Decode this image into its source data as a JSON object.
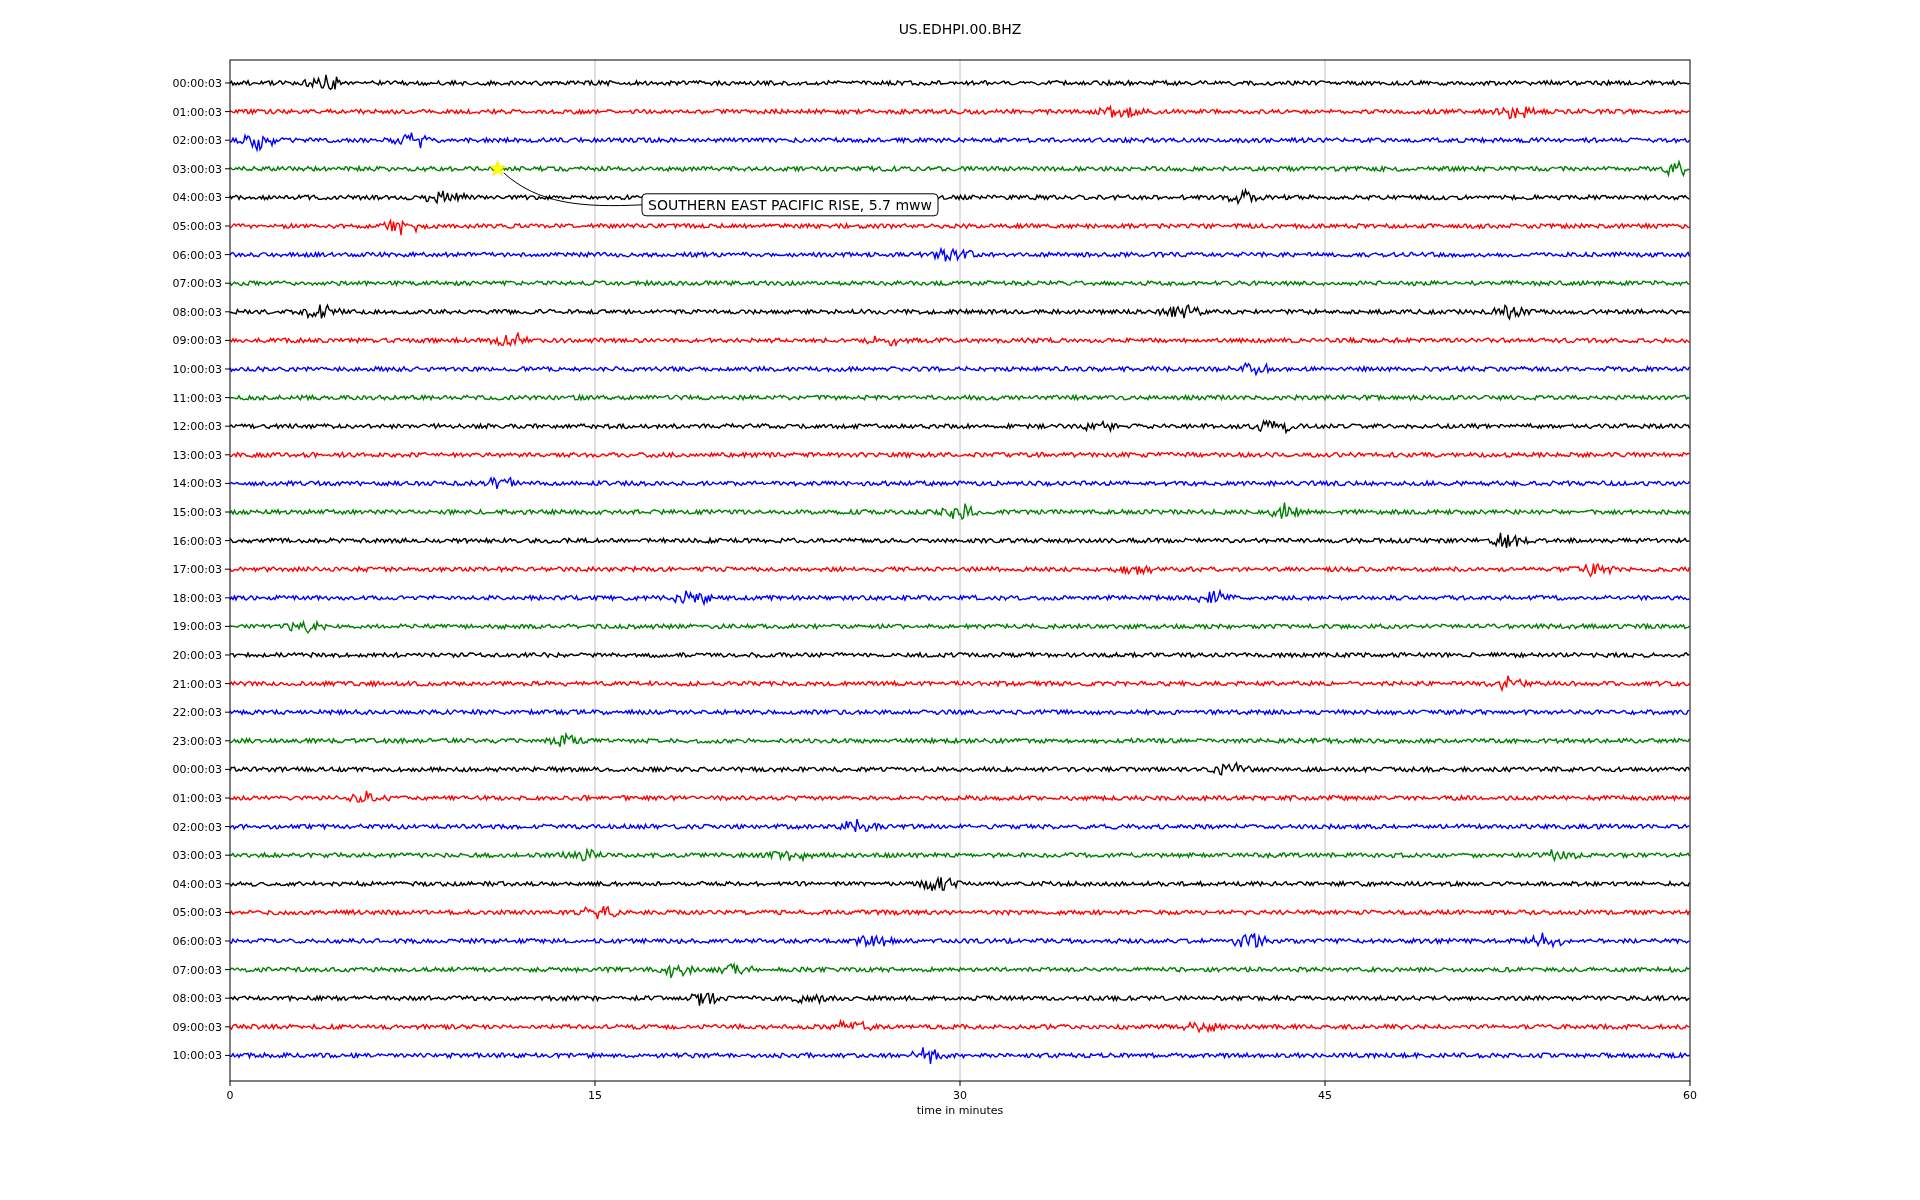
{
  "title": "US.EDHPI.00.BHZ",
  "xlabel": "time in minutes",
  "xticks": [
    "0",
    "15",
    "30",
    "45",
    "60"
  ],
  "rows": [
    {
      "label": "00:00:03",
      "color": "#000000"
    },
    {
      "label": "01:00:03",
      "color": "#ff0000"
    },
    {
      "label": "02:00:03",
      "color": "#0000ff"
    },
    {
      "label": "03:00:03",
      "color": "#008000",
      "event": "SOUTHERN EAST PACIFIC RISE, 5.7 mww"
    },
    {
      "label": "04:00:03",
      "color": "#000000"
    },
    {
      "label": "05:00:03",
      "color": "#ff0000"
    },
    {
      "label": "06:00:03",
      "color": "#0000ff"
    },
    {
      "label": "07:00:03",
      "color": "#008000"
    },
    {
      "label": "08:00:03",
      "color": "#000000"
    },
    {
      "label": "09:00:03",
      "color": "#ff0000"
    },
    {
      "label": "10:00:03",
      "color": "#0000ff"
    },
    {
      "label": "11:00:03",
      "color": "#008000"
    },
    {
      "label": "12:00:03",
      "color": "#000000"
    },
    {
      "label": "13:00:03",
      "color": "#ff0000"
    },
    {
      "label": "14:00:03",
      "color": "#0000ff"
    },
    {
      "label": "15:00:03",
      "color": "#008000"
    },
    {
      "label": "16:00:03",
      "color": "#000000"
    },
    {
      "label": "17:00:03",
      "color": "#ff0000"
    },
    {
      "label": "18:00:03",
      "color": "#0000ff"
    },
    {
      "label": "19:00:03",
      "color": "#008000"
    },
    {
      "label": "20:00:03",
      "color": "#000000"
    },
    {
      "label": "21:00:03",
      "color": "#ff0000"
    },
    {
      "label": "22:00:03",
      "color": "#0000ff"
    },
    {
      "label": "23:00:03",
      "color": "#008000"
    },
    {
      "label": "00:00:03",
      "color": "#000000"
    },
    {
      "label": "01:00:03",
      "color": "#ff0000"
    },
    {
      "label": "02:00:03",
      "color": "#0000ff"
    },
    {
      "label": "03:00:03",
      "color": "#008000"
    },
    {
      "label": "04:00:03",
      "color": "#000000"
    },
    {
      "label": "05:00:03",
      "color": "#ff0000"
    },
    {
      "label": "06:00:03",
      "color": "#0000ff"
    },
    {
      "label": "07:00:03",
      "color": "#008000"
    },
    {
      "label": "08:00:03",
      "color": "#000000"
    },
    {
      "label": "09:00:03",
      "color": "#ff0000"
    },
    {
      "label": "10:00:03",
      "color": "#0000ff"
    }
  ]
}
